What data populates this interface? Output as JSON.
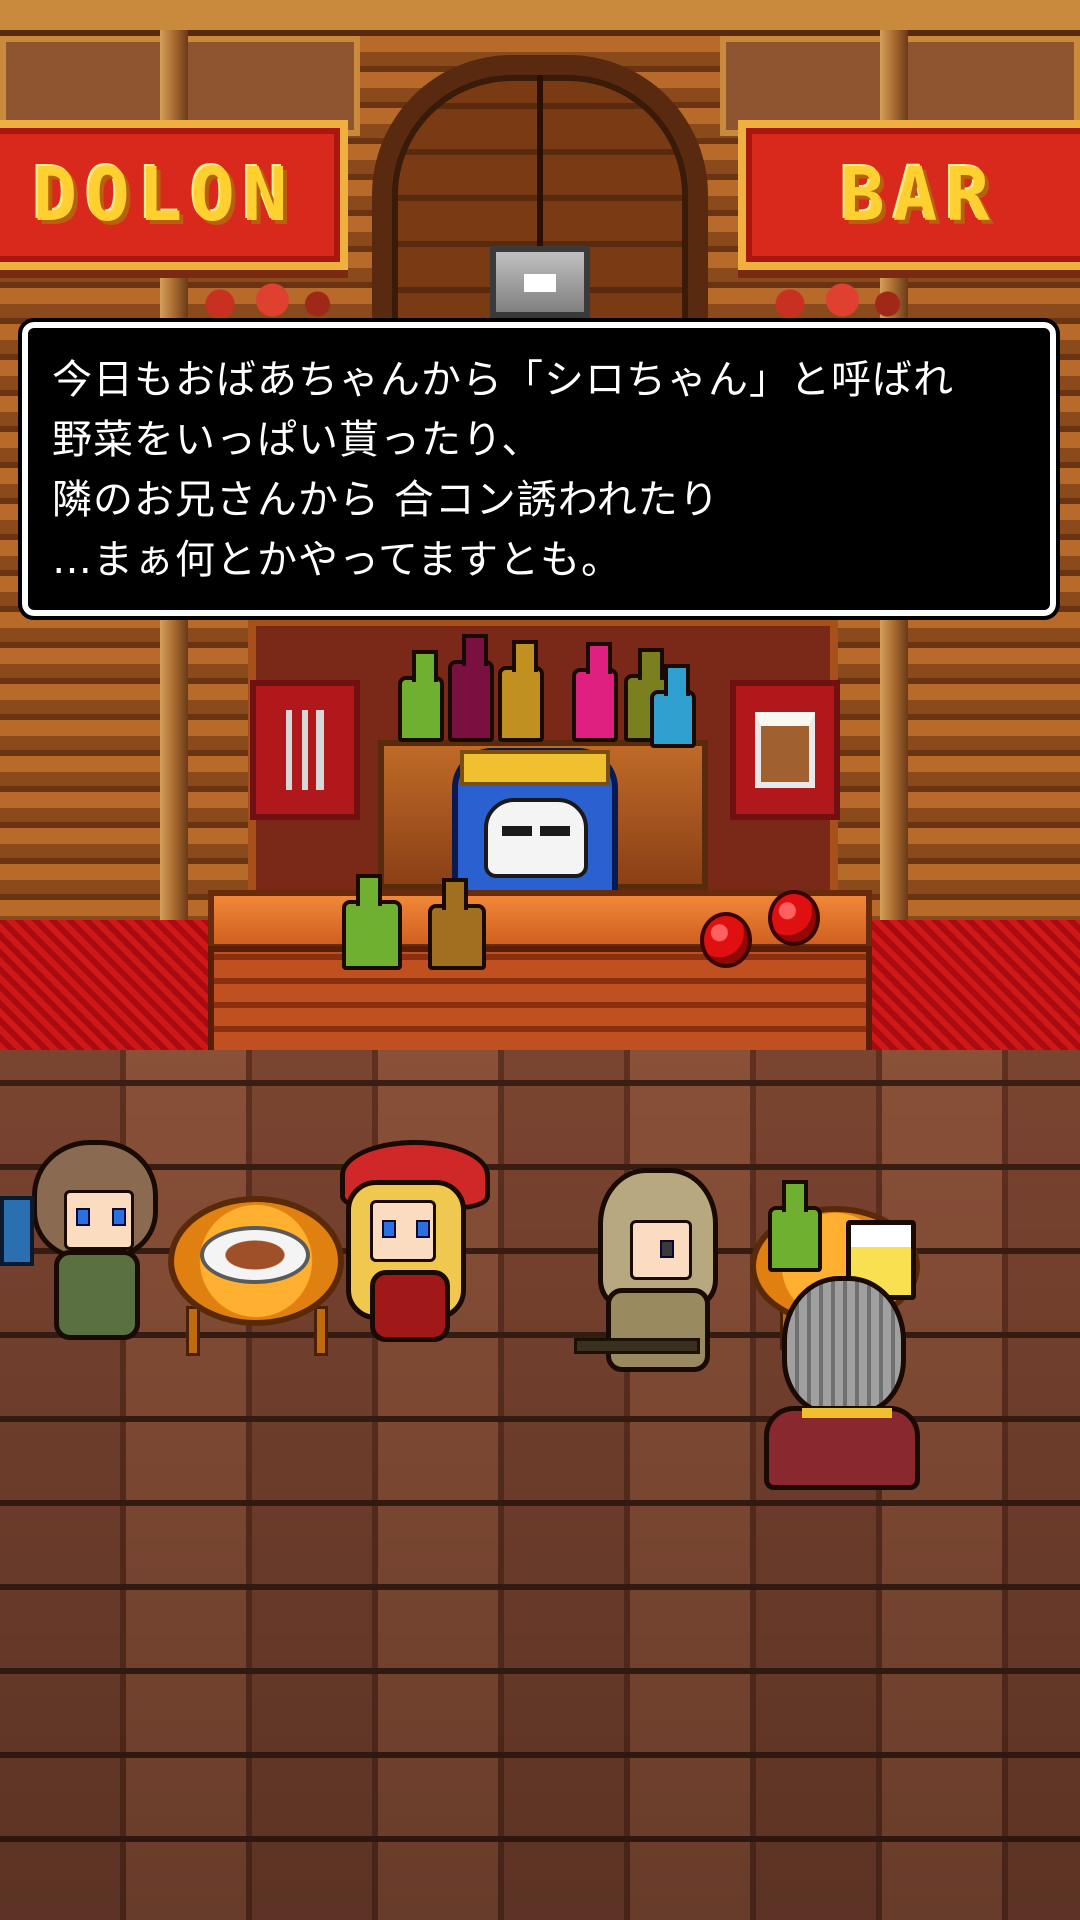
{
  "signs": {
    "left": "DOLON",
    "right": "BAR"
  },
  "dialog": {
    "lines": [
      "今日もおばあちゃんから「シロちゃん」と呼ばれ",
      "野菜をいっぱい貰ったり、",
      "隣のお兄さんから 合コン誘われたり",
      "…まぁ何とかやってますとも。"
    ]
  },
  "colors": {
    "sign_red": "#d9281c",
    "sign_text": "#ffd030",
    "dialog_bg": "#000000",
    "dialog_text": "#ffffff",
    "carpet": "#d01818",
    "floor": "#6a3a28"
  },
  "icons": {
    "poster_left": "fork-knife-icon",
    "poster_right": "beer-mug-icon",
    "door_lock": "lock-icon"
  }
}
